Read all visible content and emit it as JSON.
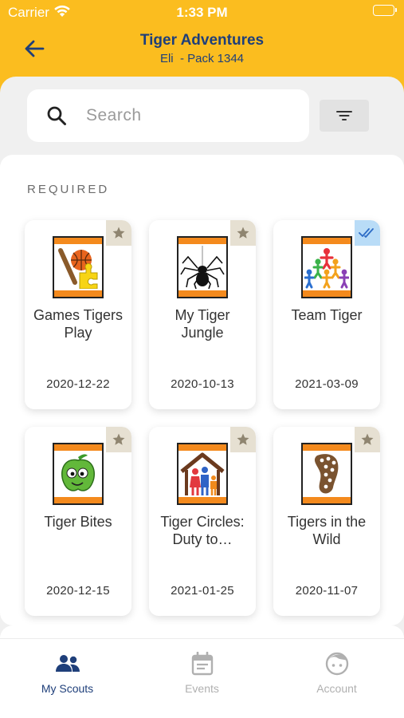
{
  "status_bar": {
    "carrier": "Carrier",
    "time": "1:33 PM"
  },
  "header": {
    "title": "Tiger Adventures",
    "subtitle": "Eli  - Pack 1344"
  },
  "search": {
    "placeholder": "Search"
  },
  "section": {
    "label": "REQUIRED"
  },
  "adventures": [
    {
      "title": "Games Tigers Play",
      "date": "2020-12-22",
      "status_icon": "star-icon"
    },
    {
      "title": "My Tiger Jungle",
      "date": "2020-10-13",
      "status_icon": "star-icon"
    },
    {
      "title": "Team Tiger",
      "date": "2021-03-09",
      "status_icon": "double-check-icon"
    },
    {
      "title": "Tiger Bites",
      "date": "2020-12-15",
      "status_icon": "star-icon"
    },
    {
      "title": "Tiger Circles: Duty to…",
      "date": "2021-01-25",
      "status_icon": "star-icon"
    },
    {
      "title": "Tigers in the Wild",
      "date": "2020-11-07",
      "status_icon": "star-icon"
    }
  ],
  "tabs": [
    {
      "label": "My Scouts",
      "icon": "people-icon",
      "active": true
    },
    {
      "label": "Events",
      "icon": "calendar-icon",
      "active": false
    },
    {
      "label": "Account",
      "icon": "face-icon",
      "active": false
    }
  ],
  "colors": {
    "brand_yellow": "#fbbd1f",
    "navy": "#1f3f7a",
    "badge_orange": "#f48a1d"
  }
}
